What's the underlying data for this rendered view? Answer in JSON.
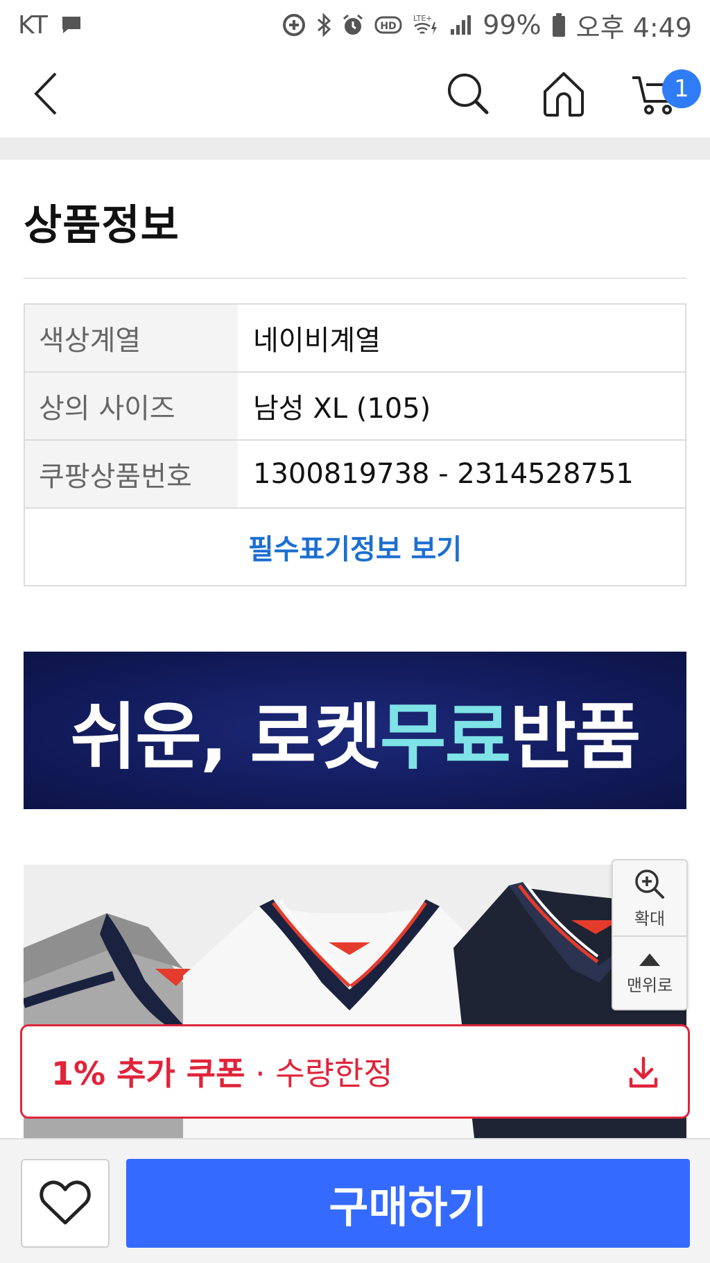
{
  "status_bar": {
    "carrier": "KT",
    "network_label": "LTE+",
    "battery_percent": "99%",
    "time": "오후 4:49",
    "icons": [
      "message-icon",
      "data-saver-icon",
      "bluetooth-icon",
      "alarm-icon",
      "hd-voice-icon",
      "wifi-calling-icon",
      "signal-icon",
      "battery-icon"
    ]
  },
  "top_nav": {
    "icons": [
      "back-arrow-icon",
      "search-icon",
      "home-icon",
      "cart-icon"
    ],
    "cart_badge": "1",
    "accent_color": "#2f7cf6"
  },
  "section": {
    "title": "상품정보"
  },
  "info_table": {
    "rows": [
      {
        "key": "색상계열",
        "value": "네이비계열"
      },
      {
        "key": "상의 사이즈",
        "value": "남성 XL (105)"
      },
      {
        "key": "쿠팡상품번호",
        "value": "1300819738 - 2314528751"
      }
    ],
    "more_link": "필수표기정보 보기",
    "link_color": "#1b6fd1"
  },
  "banner": {
    "text_before": "쉬운, 로켓",
    "text_accent": "무료",
    "text_after": "반품",
    "background": "#131c5e",
    "accent_color": "#7ee2e6"
  },
  "float_tools": {
    "zoom_label": "확대",
    "top_label": "맨위로"
  },
  "coupon": {
    "text_bold": "1% 추가 쿠폰",
    "text_rest": " · 수량한정",
    "color": "#e0243a"
  },
  "bottom_bar": {
    "buy_label": "구매하기",
    "buy_color": "#346aff"
  }
}
